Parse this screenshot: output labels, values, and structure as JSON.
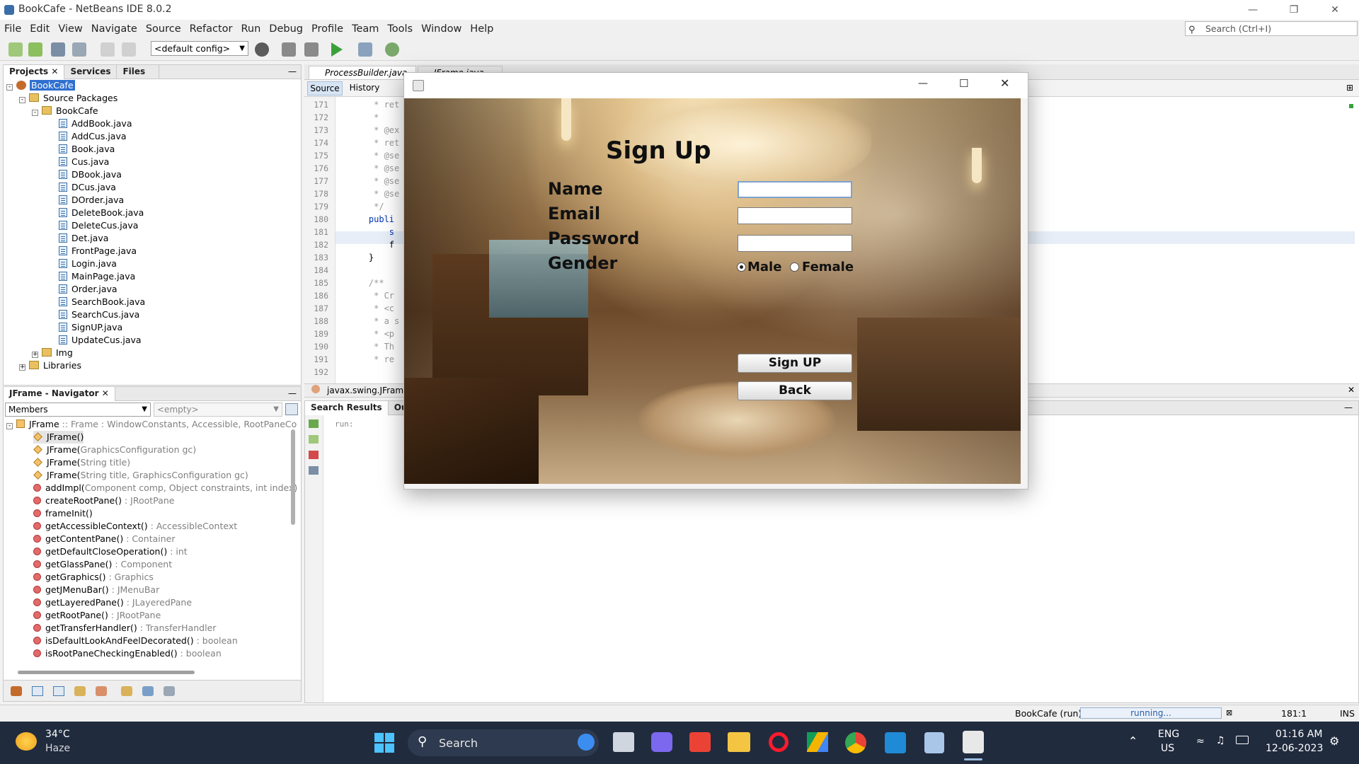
{
  "window": {
    "title": "BookCafe - NetBeans IDE 8.0.2"
  },
  "menu": [
    "File",
    "Edit",
    "View",
    "Navigate",
    "Source",
    "Refactor",
    "Run",
    "Debug",
    "Profile",
    "Team",
    "Tools",
    "Window",
    "Help"
  ],
  "search": {
    "placeholder": "Search (Ctrl+I)"
  },
  "toolbar": {
    "config": "<default config>"
  },
  "projects_panel": {
    "tabs": [
      "Projects",
      "Services",
      "Files"
    ],
    "tree": {
      "root": "BookCafe",
      "source_packages": "Source Packages",
      "package": "BookCafe",
      "files": [
        "AddBook.java",
        "AddCus.java",
        "Book.java",
        "Cus.java",
        "DBook.java",
        "DCus.java",
        "DOrder.java",
        "DeleteBook.java",
        "DeleteCus.java",
        "Det.java",
        "FrontPage.java",
        "Login.java",
        "MainPage.java",
        "Order.java",
        "SearchBook.java",
        "SearchCus.java",
        "SignUP.java",
        "UpdateCus.java"
      ],
      "img": "Img",
      "libraries": "Libraries"
    }
  },
  "navigator": {
    "title": "JFrame - Navigator",
    "filter": "Members",
    "empty": "<empty>",
    "root": {
      "name": "JFrame",
      "rest": " :: Frame : WindowConstants, Accessible, RootPaneCo"
    },
    "members": [
      {
        "name": "JFrame()",
        "type": ""
      },
      {
        "name": "JFrame(",
        "args": "GraphicsConfiguration gc)",
        "type": ""
      },
      {
        "name": "JFrame(",
        "args": "String title)",
        "type": ""
      },
      {
        "name": "JFrame(",
        "args": "String title, GraphicsConfiguration gc)",
        "type": ""
      },
      {
        "name": "addImpl(",
        "args": "Component comp, Object constraints, int index)",
        "type": ""
      },
      {
        "name": "createRootPane()",
        "type": " : JRootPane"
      },
      {
        "name": "frameInit()",
        "type": ""
      },
      {
        "name": "getAccessibleContext()",
        "type": " : AccessibleContext"
      },
      {
        "name": "getContentPane()",
        "type": " : Container"
      },
      {
        "name": "getDefaultCloseOperation()",
        "type": " : int"
      },
      {
        "name": "getGlassPane()",
        "type": " : Component"
      },
      {
        "name": "getGraphics()",
        "type": " : Graphics"
      },
      {
        "name": "getJMenuBar()",
        "type": " : JMenuBar"
      },
      {
        "name": "getLayeredPane()",
        "type": " : JLayeredPane"
      },
      {
        "name": "getRootPane()",
        "type": " : JRootPane"
      },
      {
        "name": "getTransferHandler()",
        "type": " : TransferHandler"
      },
      {
        "name": "isDefaultLookAndFeelDecorated()",
        "type": " : boolean"
      },
      {
        "name": "isRootPaneCheckingEnabled()",
        "type": " : boolean"
      }
    ]
  },
  "editor": {
    "tabs": [
      "ProcessBuilder.java",
      "JFrame.java"
    ],
    "view_tabs": [
      "Source",
      "History"
    ],
    "line_numbers": [
      "171",
      "172",
      "173",
      "174",
      "175",
      "176",
      "177",
      "178",
      "179",
      "180",
      "181",
      "182",
      "183",
      "184",
      "185",
      "186",
      "187",
      "188",
      "189",
      "190",
      "191",
      "192"
    ],
    "code_lines": [
      "     * ret",
      "     *",
      "     * @ex",
      "     * ret",
      "     * @se",
      "     * @se",
      "     * @se",
      "     * @se",
      "     */",
      "    publi",
      "        s",
      "        f",
      "    }",
      "",
      "    /**",
      "     * Cr",
      "     * <c",
      "     * a s",
      "     * <p",
      "     * Th",
      "     * re",
      ""
    ],
    "breadcrumb": "javax.swing.JFrame"
  },
  "output": {
    "tabs": [
      "Search Results",
      "Outp"
    ],
    "text": "run:"
  },
  "status": {
    "project": "BookCafe (run)",
    "progress": "running...",
    "position": "181:1",
    "mode": "INS"
  },
  "dialog": {
    "heading": "Sign Up",
    "labels": {
      "name": "Name",
      "email": "Email",
      "password": "Password",
      "gender": "Gender"
    },
    "gender_options": {
      "male": "Male",
      "female": "Female"
    },
    "gender_selected": "Male",
    "buttons": {
      "signup": "Sign UP",
      "back": "Back"
    }
  },
  "taskbar": {
    "weather": {
      "temp": "34°C",
      "condition": "Haze"
    },
    "search": "Search",
    "lang": {
      "line1": "ENG",
      "line2": "US"
    },
    "time": "01:16 AM",
    "date": "12-06-2023"
  }
}
